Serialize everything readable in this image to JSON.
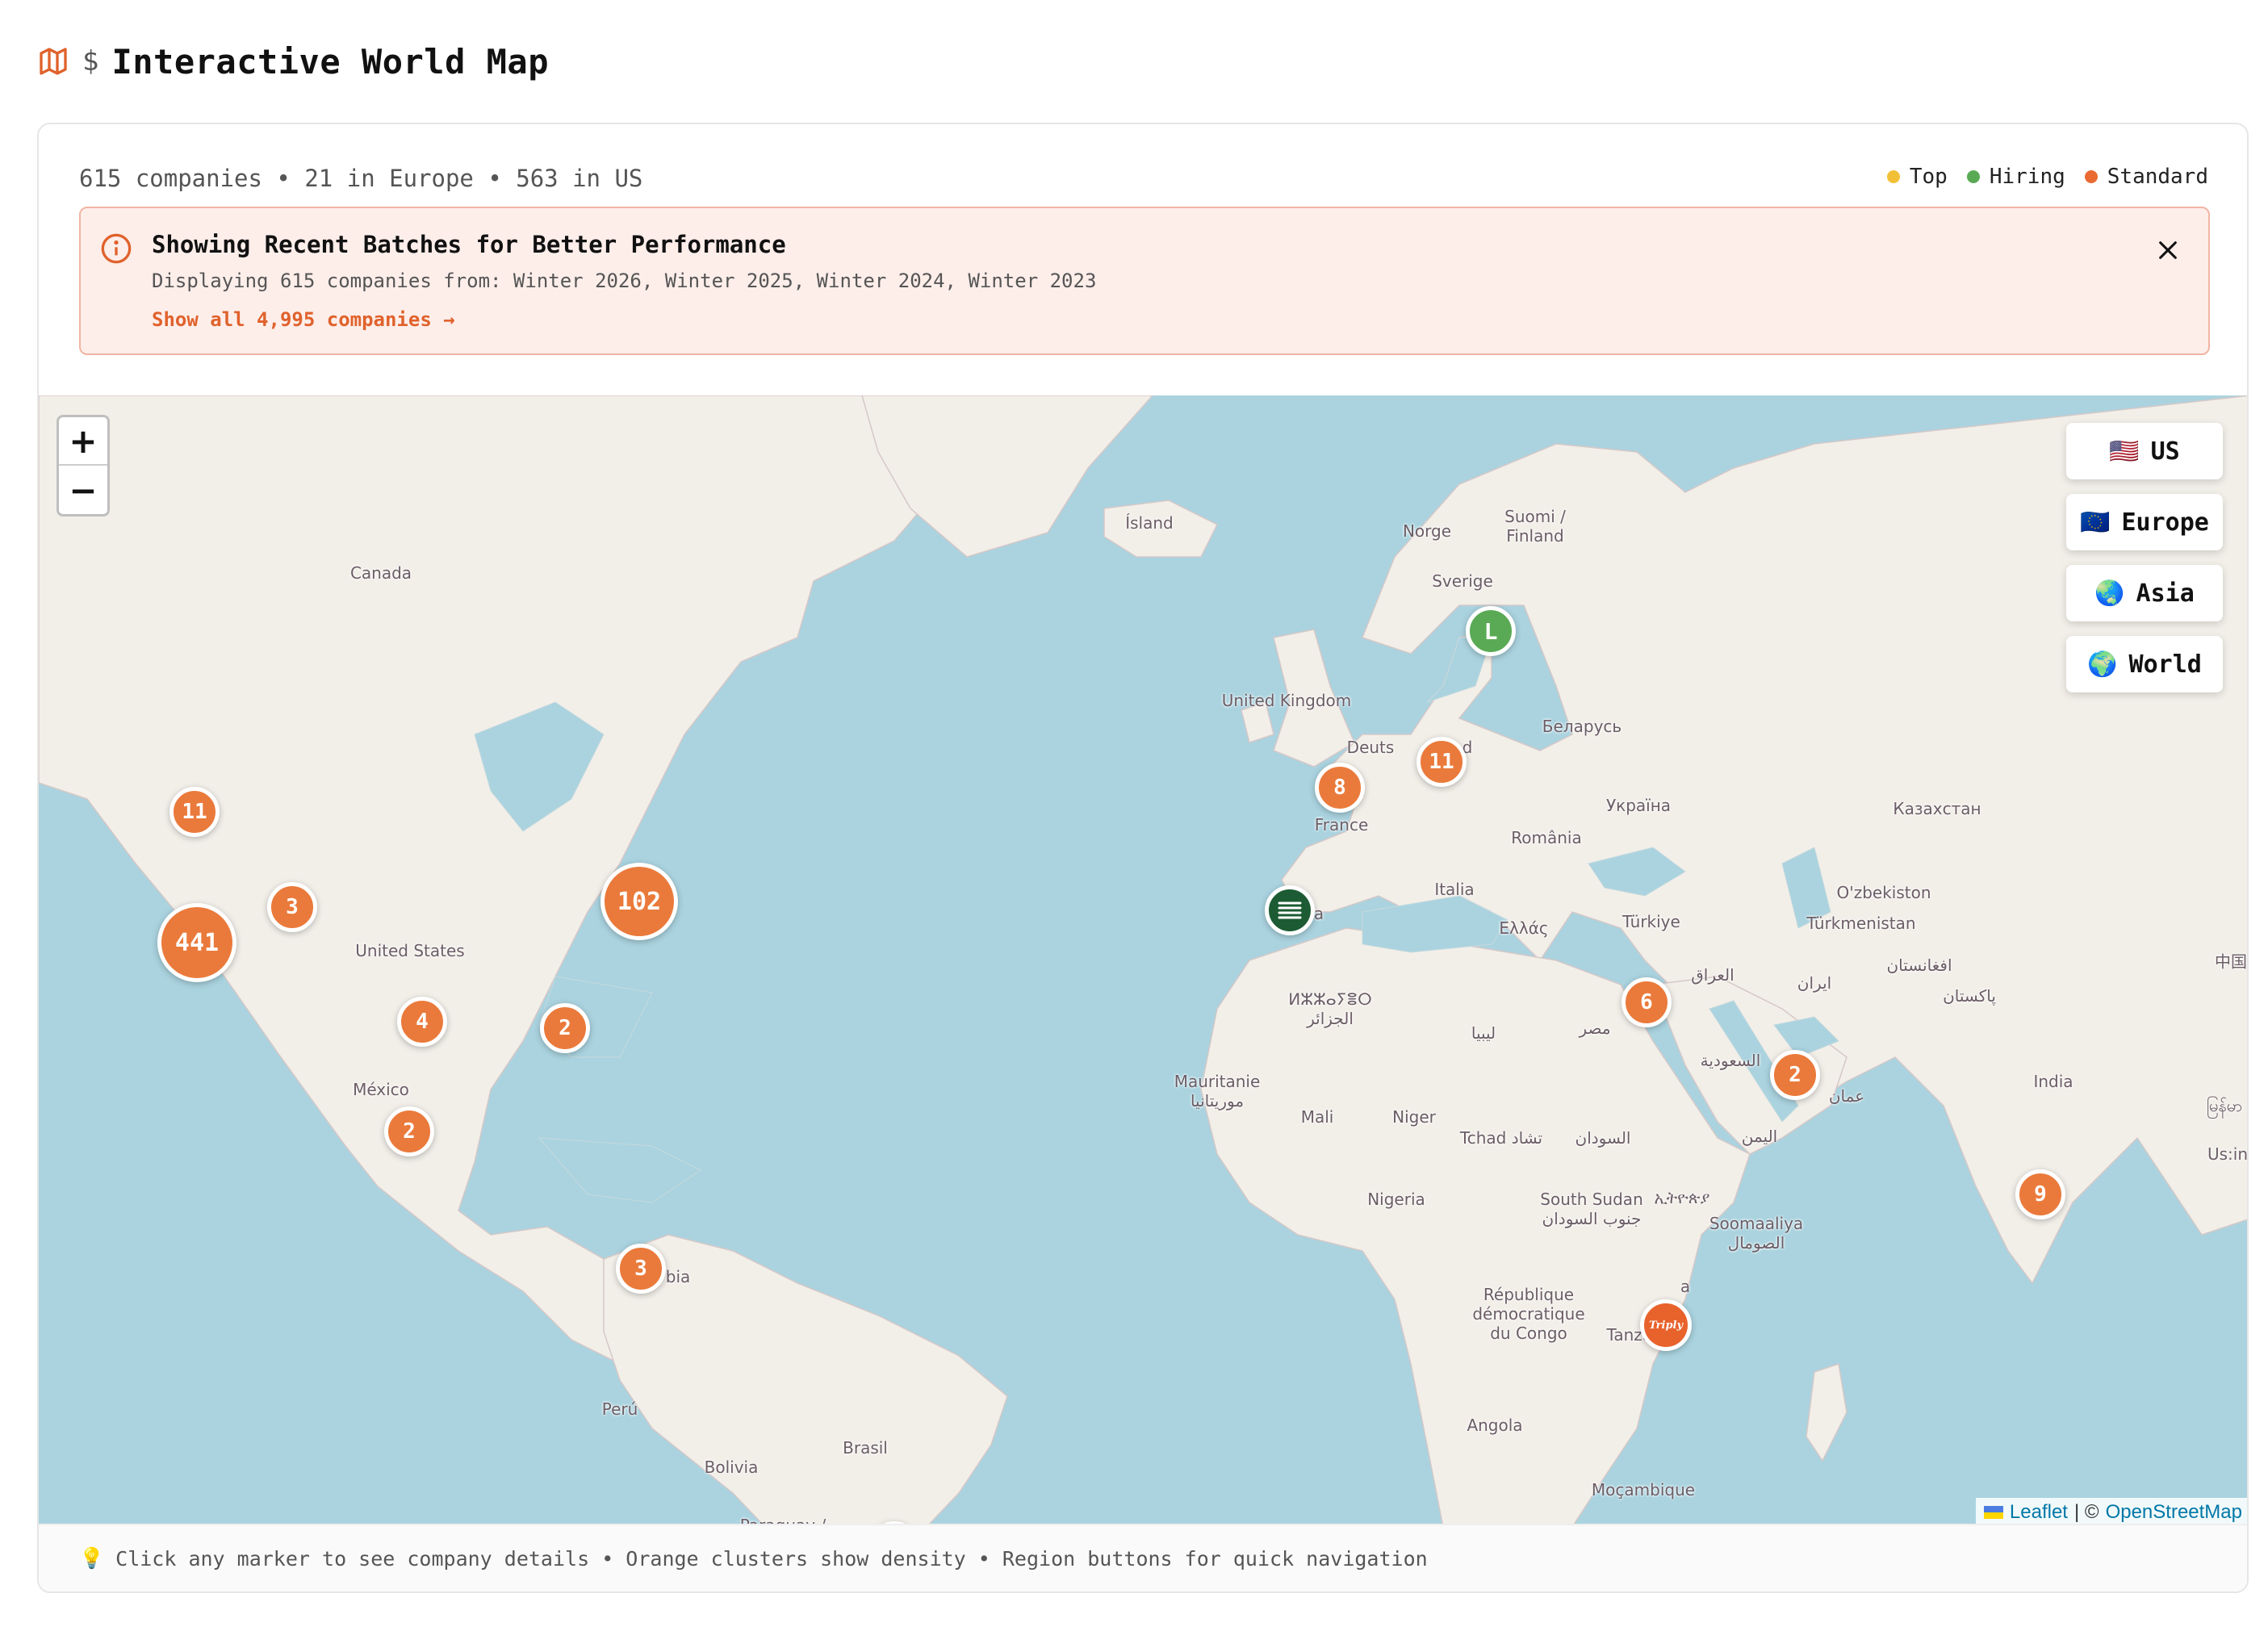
{
  "header": {
    "dollar": "$",
    "title": "Interactive World Map"
  },
  "stats": "615 companies • 21 in Europe • 563 in US",
  "legend": [
    {
      "label": "Top",
      "color": "#f2c037"
    },
    {
      "label": "Hiring",
      "color": "#5aaa55"
    },
    {
      "label": "Standard",
      "color": "#ea6a33"
    }
  ],
  "notice": {
    "title": "Showing Recent Batches for Better Performance",
    "subtitle": "Displaying 615 companies from: Winter 2026, Winter 2025, Winter 2024, Winter 2023",
    "link": "Show all 4,995 companies →"
  },
  "zoom": {
    "in": "+",
    "out": "−"
  },
  "regions": [
    {
      "label": "US",
      "flag": "🇺🇸"
    },
    {
      "label": "Europe",
      "flag": "🇪🇺"
    },
    {
      "label": "Asia",
      "flag": "🌏"
    },
    {
      "label": "World",
      "flag": "🌍"
    }
  ],
  "map_labels": {
    "canada": "Canada",
    "us": "United States",
    "mexico": "México",
    "colombia": "bia",
    "peru": "Perú",
    "bolivia": "Bolivia",
    "brasil": "Brasil",
    "paraguay": "Paraguay /",
    "island": "Ísland",
    "norge": "Norge",
    "suomi1": "Suomi /",
    "suomi2": "Finland",
    "sverige": "Sverige",
    "uk": "United Kingdom",
    "belarus": "Беларусь",
    "deutschland1": "Deuts",
    "deutschland2": "d",
    "ukraine": "Україна",
    "france": "France",
    "romania": "România",
    "kazakhstan": "Казахстан",
    "italia": "Italia",
    "uzbekistan": "O'zbekiston",
    "ellada": "Ελλάς",
    "turkiye": "Türkiye",
    "turkmenistan": "Türkmenistan",
    "china": "中国",
    "algeria1": "ⵍⵣⵣⴰⵢⴻⵔ",
    "algeria2": "الجزائر",
    "iraq": "العراق",
    "iran": "ایران",
    "afghanistan": "افغانستان",
    "pakistan": "پاکستان",
    "libya": "ليبيا",
    "egypt": "مصر",
    "saudi": "السعودية",
    "oman": "عمان",
    "india": "India",
    "myanmar": "မြန်မာ",
    "mauritanie1": "Mauritanie",
    "mauritanie2": "موريتانيا",
    "mali": "Mali",
    "niger": "Niger",
    "tchad": "Tchad تشاد",
    "sudan": "السودان",
    "yemen": "اليمن",
    "srilanka": "Us:in",
    "nigeria": "Nigeria",
    "southsudan1": "South Sudan",
    "southsudan2": "جنوب السودان",
    "ethiopia": "ኢትዮጵያ",
    "somalia1": "Soomaaliya",
    "somalia2": "الصومال",
    "drc1": "République",
    "drc2": "démocratique",
    "drc3": "du Congo",
    "kenya": "a",
    "tanzania": "Tanzania",
    "angola": "Angola",
    "mozambique": "Moçambique",
    "spain": "a"
  },
  "markers": [
    {
      "id": "seattle",
      "label": "11",
      "type": "cluster"
    },
    {
      "id": "sf",
      "label": "441",
      "type": "cluster"
    },
    {
      "id": "utah",
      "label": "3",
      "type": "cluster"
    },
    {
      "id": "nyc",
      "label": "102",
      "type": "cluster"
    },
    {
      "id": "texas",
      "label": "4",
      "type": "cluster"
    },
    {
      "id": "florida",
      "label": "2",
      "type": "cluster"
    },
    {
      "id": "mexico",
      "label": "2",
      "type": "cluster"
    },
    {
      "id": "colombia",
      "label": "3",
      "type": "cluster"
    },
    {
      "id": "sweden",
      "label": "L",
      "type": "hiring-logo"
    },
    {
      "id": "germany",
      "label": "11",
      "type": "cluster"
    },
    {
      "id": "france",
      "label": "8",
      "type": "cluster"
    },
    {
      "id": "spain",
      "label": "",
      "type": "company-logo"
    },
    {
      "id": "israel",
      "label": "6",
      "type": "cluster"
    },
    {
      "id": "uae",
      "label": "2",
      "type": "cluster"
    },
    {
      "id": "india",
      "label": "9",
      "type": "cluster"
    },
    {
      "id": "kenya",
      "label": "Triply",
      "type": "company-logo"
    }
  ],
  "attribution": {
    "leaflet": "Leaflet",
    "separator": "| ©",
    "osm": "OpenStreetMap"
  },
  "footer": {
    "icon": "💡",
    "text": "Click any marker to see company details • Orange clusters show density • Region buttons for quick navigation"
  }
}
